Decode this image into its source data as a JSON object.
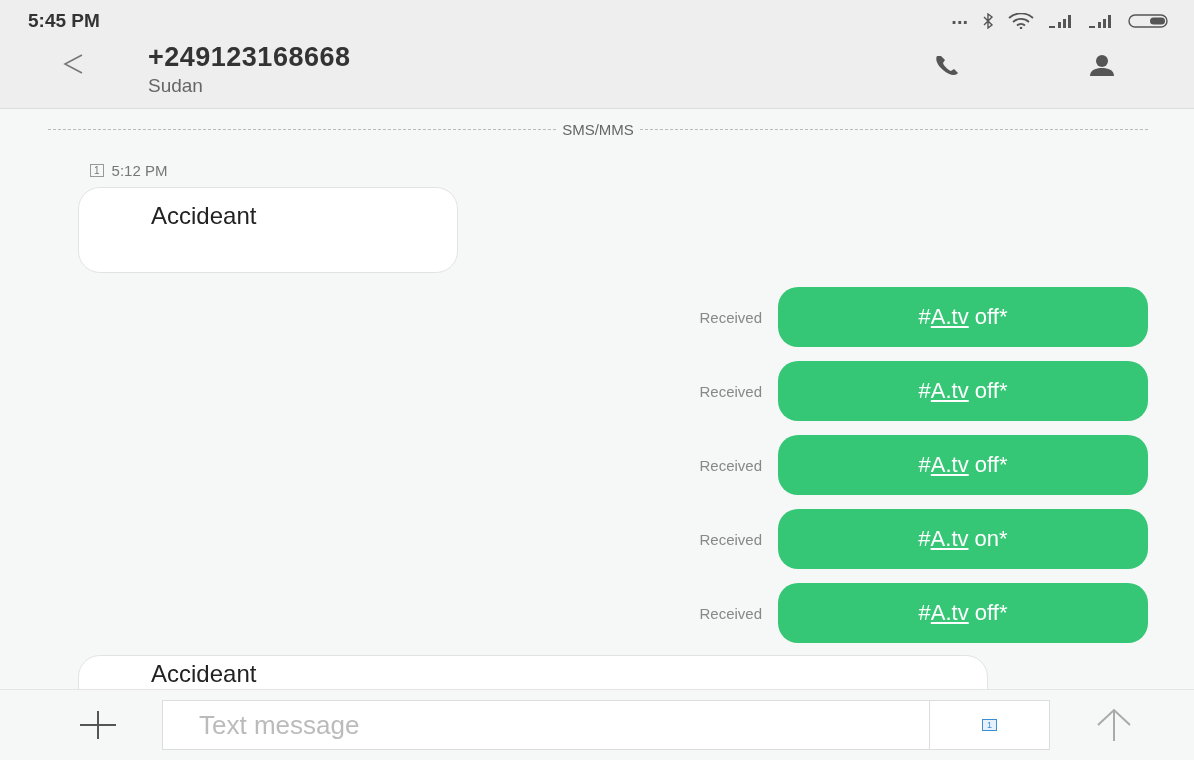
{
  "status_bar": {
    "time": "5:45 PM",
    "dots": "..."
  },
  "header": {
    "title": "+249123168668",
    "subtitle": "Sudan"
  },
  "divider_label": "SMS/MMS",
  "messages": [
    {
      "kind": "incoming",
      "sim": "1",
      "time": "5:12 PM",
      "text": "Accideant"
    },
    {
      "kind": "outgoing",
      "status": "Received",
      "prefix": "#",
      "link": "A.tv",
      "rest": " off*"
    },
    {
      "kind": "outgoing",
      "status": "Received",
      "prefix": "#",
      "link": "A.tv",
      "rest": " off*"
    },
    {
      "kind": "outgoing",
      "status": "Received",
      "prefix": "#",
      "link": "A.tv",
      "rest": " off*"
    },
    {
      "kind": "outgoing",
      "status": "Received",
      "prefix": "#",
      "link": "A.tv",
      "rest": " on*"
    },
    {
      "kind": "outgoing",
      "status": "Received",
      "prefix": "#",
      "link": "A.tv",
      "rest": " off*"
    },
    {
      "kind": "incoming",
      "text": "Accideant"
    }
  ],
  "composer": {
    "placeholder": "Text message",
    "sim": "1"
  }
}
